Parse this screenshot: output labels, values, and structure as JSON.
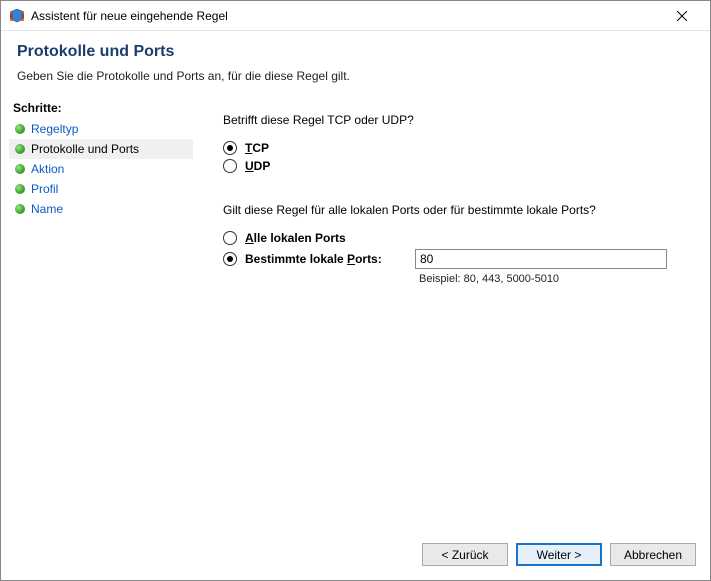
{
  "window": {
    "title": "Assistent für neue eingehende Regel"
  },
  "header": {
    "title": "Protokolle und Ports",
    "subtitle": "Geben Sie die Protokolle und Ports an, für die diese Regel gilt."
  },
  "sidebar": {
    "title": "Schritte:",
    "steps": [
      {
        "label": "Regeltyp",
        "current": false
      },
      {
        "label": "Protokolle und Ports",
        "current": true
      },
      {
        "label": "Aktion",
        "current": false
      },
      {
        "label": "Profil",
        "current": false
      },
      {
        "label": "Name",
        "current": false
      }
    ]
  },
  "content": {
    "protocol_question": "Betrifft diese Regel TCP oder UDP?",
    "tcp": {
      "mnemonic": "T",
      "rest": "CP",
      "checked": true
    },
    "udp": {
      "mnemonic": "U",
      "rest": "DP",
      "checked": false
    },
    "port_question": "Gilt diese Regel für alle lokalen Ports oder für bestimmte lokale Ports?",
    "all_ports": {
      "mnemonic": "A",
      "rest": "lle lokalen Ports",
      "checked": false
    },
    "specific_ports": {
      "pre": "Bestimmte lokale ",
      "mnemonic": "P",
      "post": "orts:",
      "checked": true
    },
    "port_value": "80",
    "example": "Beispiel: 80, 443, 5000-5010"
  },
  "buttons": {
    "back": "< Zurück",
    "next": "Weiter >",
    "cancel": "Abbrechen"
  }
}
